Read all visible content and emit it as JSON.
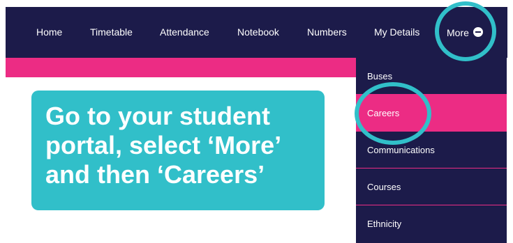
{
  "nav": {
    "items": [
      {
        "label": "Home"
      },
      {
        "label": "Timetable"
      },
      {
        "label": "Attendance"
      },
      {
        "label": "Notebook"
      },
      {
        "label": "Numbers"
      },
      {
        "label": "My Details"
      },
      {
        "label": "More"
      }
    ]
  },
  "dropdown": {
    "items": [
      {
        "label": "Buses"
      },
      {
        "label": "Careers",
        "selected": true
      },
      {
        "label": "Communications"
      },
      {
        "label": "Courses"
      },
      {
        "label": "Ethnicity"
      }
    ]
  },
  "callout": {
    "lines": [
      "Go to your student",
      "portal, select ‘More’",
      "and then ‘Careers’"
    ]
  },
  "colors": {
    "navbar": "#1c1b4a",
    "accent_pink": "#ec2c84",
    "highlight_teal": "#31bfc9",
    "text": "#ffffff"
  },
  "icons": {
    "more_toggle": "minus-circle-icon"
  }
}
